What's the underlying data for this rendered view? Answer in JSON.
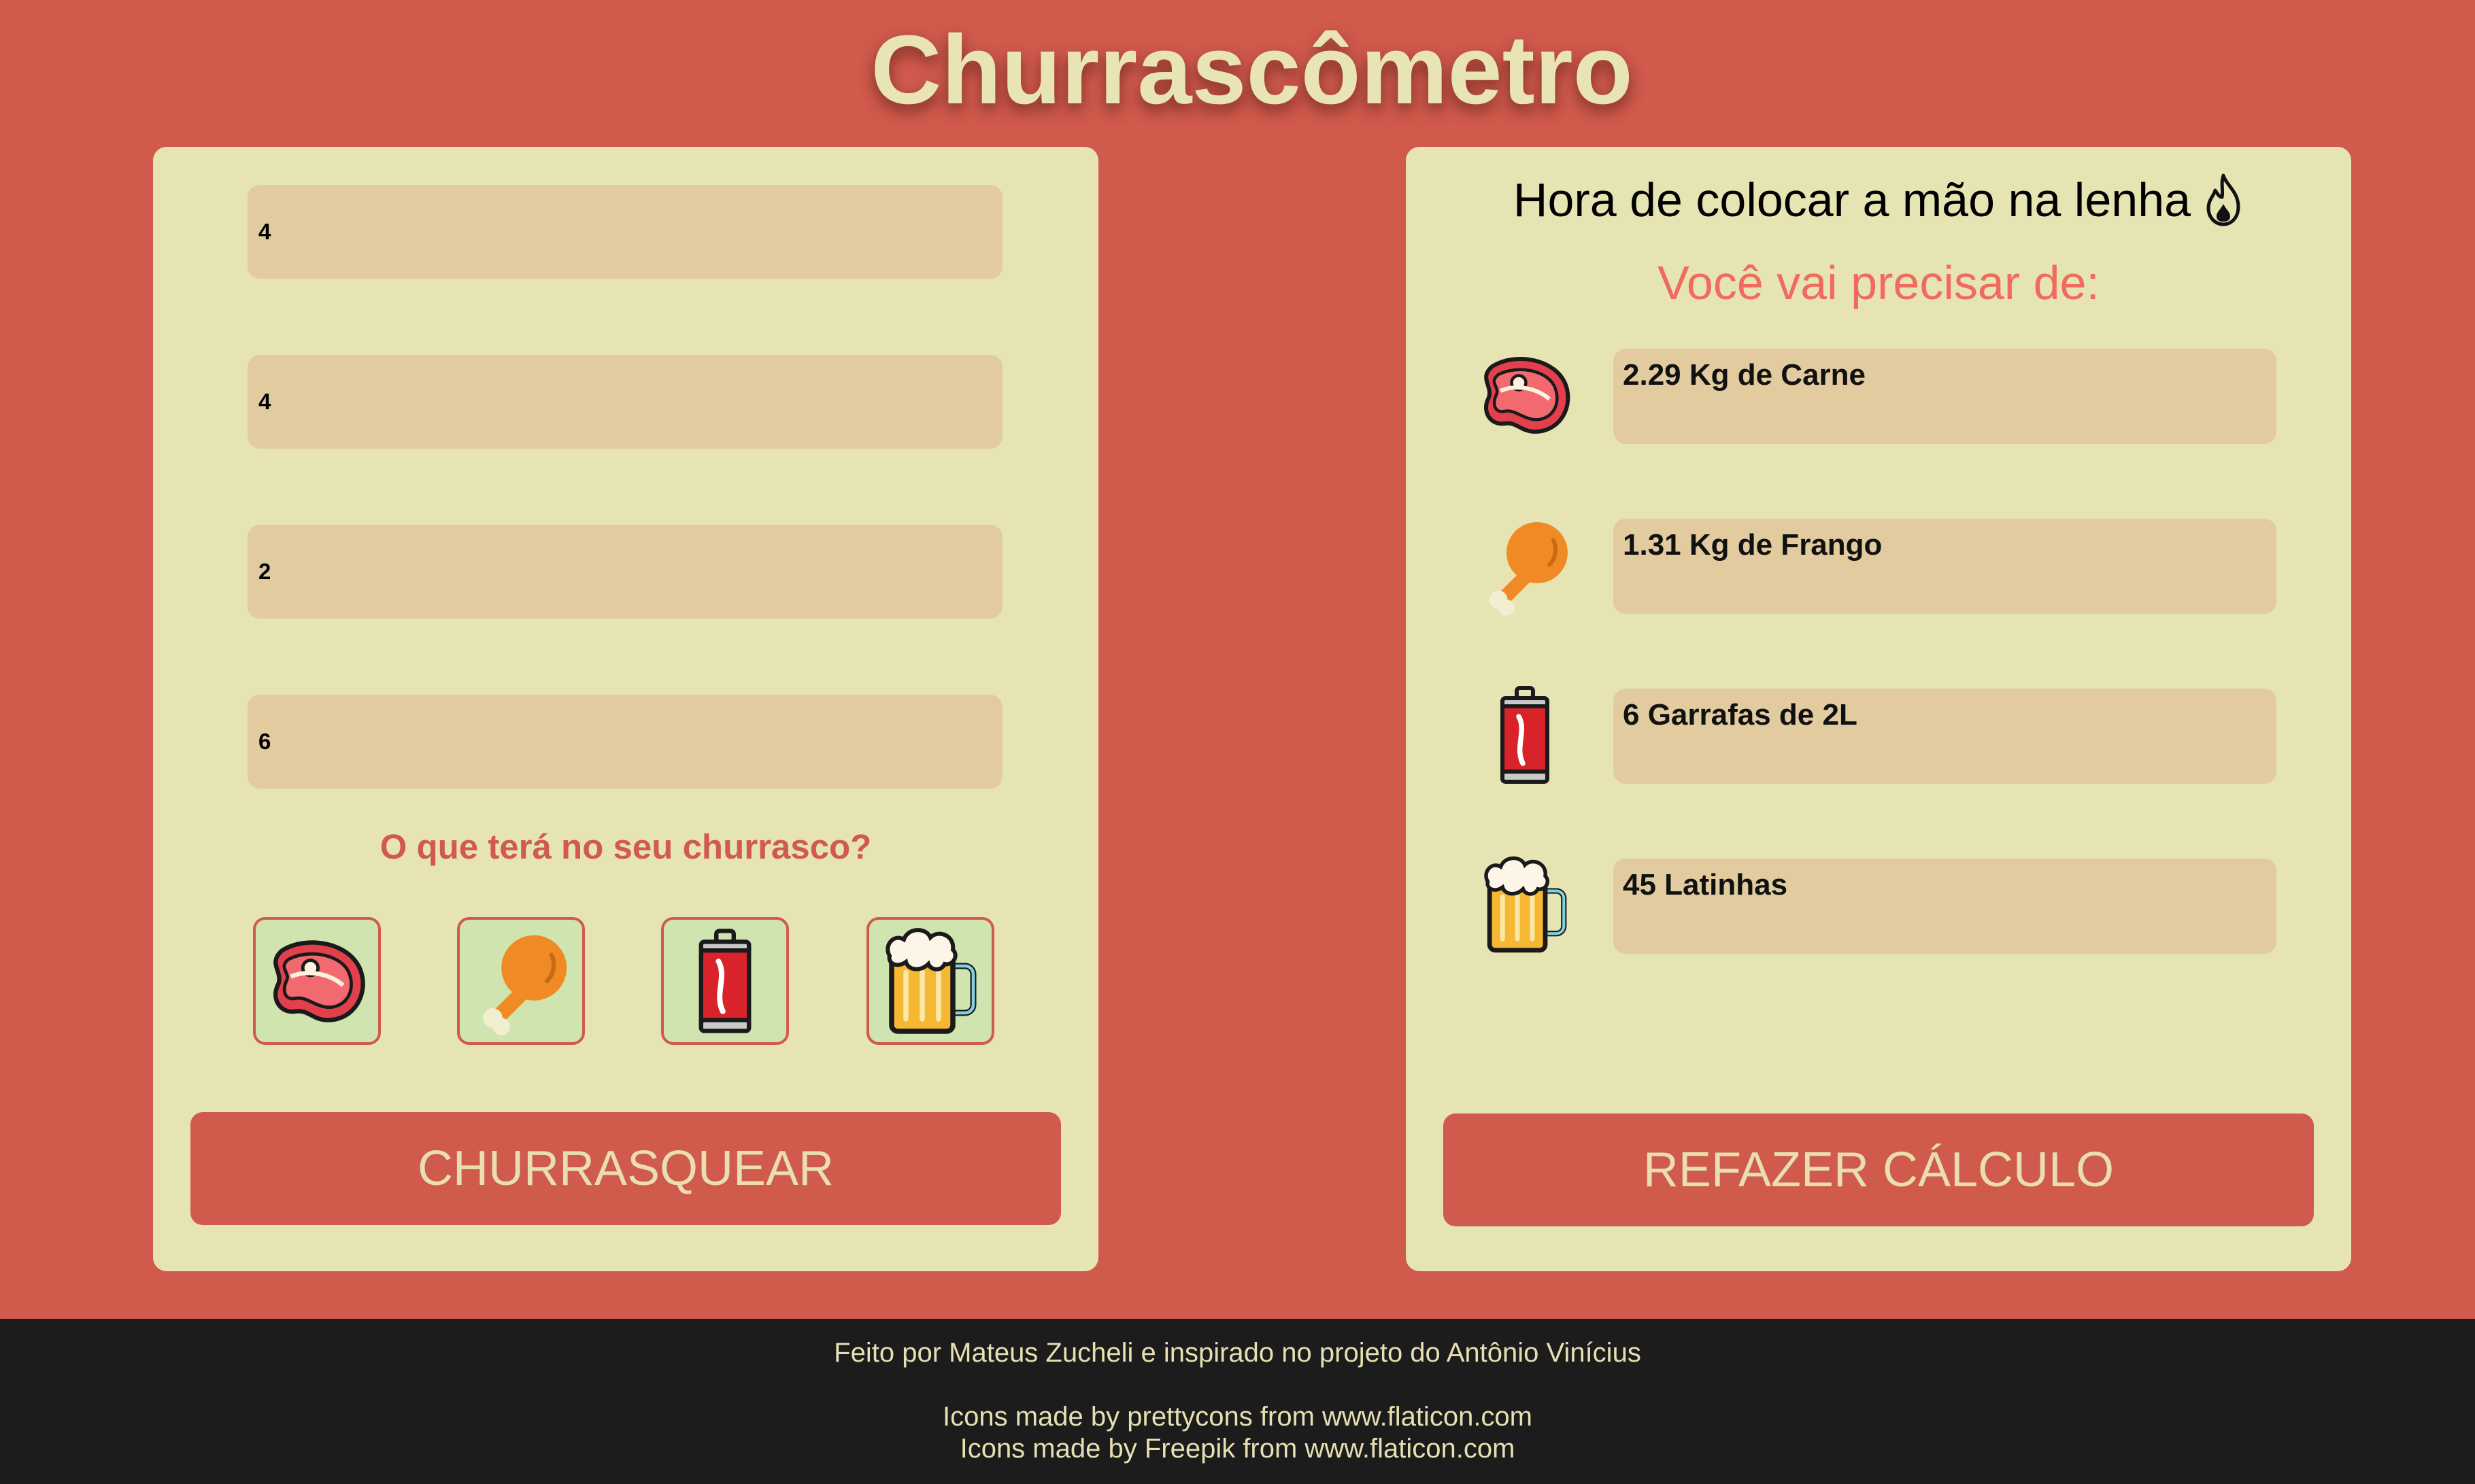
{
  "app": {
    "title": "Churrascômetro"
  },
  "form": {
    "inputs": [
      {
        "value": "4"
      },
      {
        "value": "4"
      },
      {
        "value": "2"
      },
      {
        "value": "6"
      }
    ],
    "question": "O que terá no seu churrasco?",
    "options": [
      {
        "icon": "steak-icon"
      },
      {
        "icon": "chicken-leg-icon"
      },
      {
        "icon": "soda-can-icon"
      },
      {
        "icon": "beer-mug-icon"
      }
    ],
    "submit_label": "CHURRASQUEAR"
  },
  "result": {
    "title": "Hora de colocar a mão na lenha",
    "title_icon": "fire-icon",
    "subtitle": "Você vai precisar de:",
    "items": [
      {
        "icon": "steak-icon",
        "text": "2.29 Kg de Carne"
      },
      {
        "icon": "chicken-leg-icon",
        "text": "1.31 Kg de Frango"
      },
      {
        "icon": "soda-can-icon",
        "text": "6 Garrafas de 2L"
      },
      {
        "icon": "beer-mug-icon",
        "text": "45 Latinhas"
      }
    ],
    "redo_label": "REFAZER CÁLCULO"
  },
  "footer": {
    "credit": "Feito por Mateus Zucheli e inspirado no projeto do Antônio Vinícius",
    "icons_line1": "Icons made by prettycons from www.flaticon.com",
    "icons_line2": "Icons made by Freepik from www.flaticon.com"
  },
  "colors": {
    "background": "#d05a4c",
    "card": "#e6e4b3",
    "field": "#e1cb9f",
    "option_bg": "#cfe4ae",
    "title": "#e9e4b4",
    "subtitle": "#f16a5e",
    "footer_bg": "#1c1c1c"
  }
}
